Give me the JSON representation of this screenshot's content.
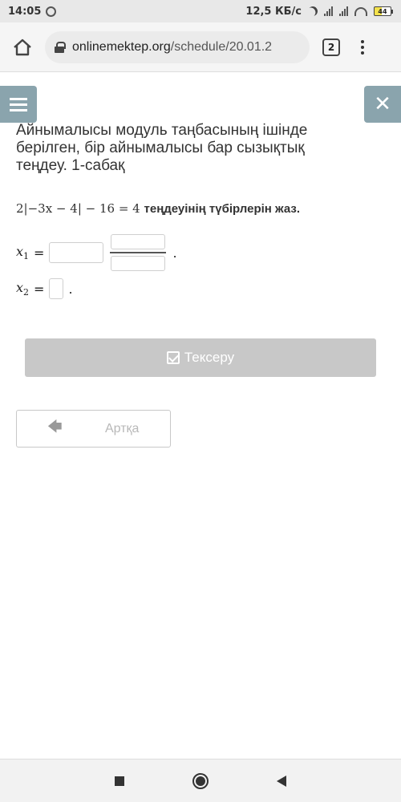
{
  "status_bar": {
    "time": "14:05",
    "network_speed": "12,5 КБ/с",
    "battery_level": "44"
  },
  "browser": {
    "url_domain": "onlinemektep.org",
    "url_path": "/schedule/20.01.2",
    "tab_count": "2"
  },
  "page": {
    "title": "Айнымалысы модуль таңбасының ішінде берілген, бір айнымалысы бар сызықтық теңдеу. 1-сабақ",
    "task_equation": "2|−3x − 4| − 16 = 4",
    "task_text": "теңдеуінің түбірлерін жаз.",
    "x1_label": "x",
    "x1_sub": "1",
    "x2_label": "x",
    "x2_sub": "2",
    "equals": "=",
    "period": ".",
    "check_button_label": "Тексеру",
    "back_button_label": "Артқа"
  },
  "icons": {
    "home": "home-icon",
    "lock": "lock-icon",
    "menu": "more-vert-icon",
    "hamburger": "hamburger-icon",
    "close": "close-icon",
    "check": "checkbox-check-icon",
    "back_arrow": "arrow-left-icon"
  },
  "colors": {
    "side_button": "#8aa4ad",
    "check_button": "#c8c8c8"
  }
}
